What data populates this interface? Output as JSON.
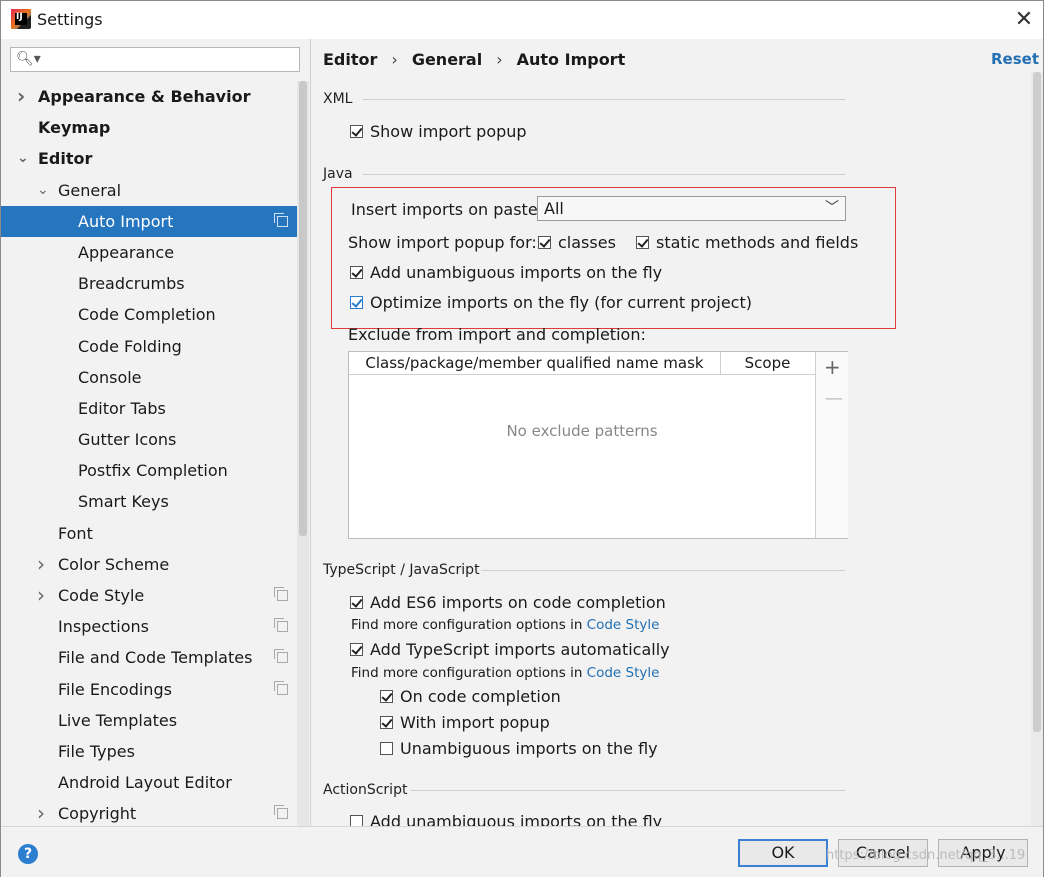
{
  "window": {
    "title": "Settings",
    "app_icon_text": "IJ"
  },
  "search": {
    "placeholder": ""
  },
  "sidebar": {
    "items": [
      {
        "label": "Appearance & Behavior",
        "indent": 0,
        "arrow": "right",
        "bold": true
      },
      {
        "label": "Keymap",
        "indent": 0,
        "arrow": "",
        "bold": true
      },
      {
        "label": "Editor",
        "indent": 0,
        "arrow": "down",
        "bold": true
      },
      {
        "label": "General",
        "indent": 1,
        "arrow": "down"
      },
      {
        "label": "Auto Import",
        "indent": 2,
        "selected": true,
        "copy": true
      },
      {
        "label": "Appearance",
        "indent": 2
      },
      {
        "label": "Breadcrumbs",
        "indent": 2
      },
      {
        "label": "Code Completion",
        "indent": 2
      },
      {
        "label": "Code Folding",
        "indent": 2
      },
      {
        "label": "Console",
        "indent": 2
      },
      {
        "label": "Editor Tabs",
        "indent": 2
      },
      {
        "label": "Gutter Icons",
        "indent": 2
      },
      {
        "label": "Postfix Completion",
        "indent": 2
      },
      {
        "label": "Smart Keys",
        "indent": 2
      },
      {
        "label": "Font",
        "indent": 1
      },
      {
        "label": "Color Scheme",
        "indent": 1,
        "arrow": "right"
      },
      {
        "label": "Code Style",
        "indent": 1,
        "arrow": "right",
        "copy": true
      },
      {
        "label": "Inspections",
        "indent": 1,
        "copy": true
      },
      {
        "label": "File and Code Templates",
        "indent": 1,
        "copy": true
      },
      {
        "label": "File Encodings",
        "indent": 1,
        "copy": true
      },
      {
        "label": "Live Templates",
        "indent": 1
      },
      {
        "label": "File Types",
        "indent": 1
      },
      {
        "label": "Android Layout Editor",
        "indent": 1
      },
      {
        "label": "Copyright",
        "indent": 1,
        "arrow": "right",
        "copy": true
      }
    ]
  },
  "breadcrumb": {
    "items": [
      "Editor",
      "General",
      "Auto Import"
    ],
    "separator": "›"
  },
  "reset_label": "Reset",
  "xml": {
    "title": "XML",
    "show_popup": "Show import popup"
  },
  "java": {
    "title": "Java",
    "insert_label": "Insert imports on paste:",
    "insert_value": "All",
    "show_popup_for": "Show import popup for:",
    "classes": "classes",
    "static": "static methods and fields",
    "unambiguous": "Add unambiguous imports on the fly",
    "optimize": "Optimize imports on the fly (for current project)",
    "exclude_label": "Exclude from import and completion:",
    "col1": "Class/package/member qualified name mask",
    "col2": "Scope",
    "empty": "No exclude patterns",
    "add_sym": "+",
    "remove_sym": "—"
  },
  "ts": {
    "title": "TypeScript / JavaScript",
    "es6": "Add ES6 imports on code completion",
    "find_more": "Find more configuration options in",
    "code_style": "Code Style",
    "ts_auto": "Add TypeScript imports automatically",
    "on_completion": "On code completion",
    "with_popup": "With import popup",
    "unambiguous": "Unambiguous imports on the fly"
  },
  "actionscript": {
    "title": "ActionScript",
    "unambiguous": "Add unambiguous imports on the fly"
  },
  "footer": {
    "help": "?",
    "ok": "OK",
    "cancel": "Cancel",
    "apply": "Apply",
    "watermark": "https://blog.csdn.net/qq_3...19"
  }
}
